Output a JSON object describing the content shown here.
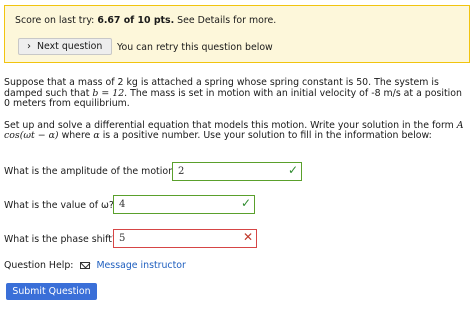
{
  "score": {
    "prefix": "Score on last try:",
    "value": "6.67 of 10 pts.",
    "suffix": "See Details for more."
  },
  "next_button": {
    "label": "Next question"
  },
  "retry_text": "You can retry this question below",
  "question": {
    "para1_a": "Suppose that a mass of 2 kg is attached a spring whose spring constant is 50. The system is damped such that",
    "para1_b": "b = 12",
    "para1_c": ". The mass is set in motion with an initial velocity of -8 m/s at a position 0 meters from equilibrium.",
    "para2_a": "Set up and solve a differential equation that models this motion. Write your solution in the form",
    "para2_math": "A cos(ωt − α)",
    "para2_b": "where",
    "para2_alpha": "α",
    "para2_c": "is a positive number. Use your solution to fill in the information below:"
  },
  "parts": [
    {
      "label": "What is the amplitude of the motion?",
      "value": "2",
      "status": "correct"
    },
    {
      "label": "What is the value of ω?",
      "value": "4",
      "status": "correct"
    },
    {
      "label": "What is the phase shift?",
      "value": "5",
      "status": "incorrect"
    }
  ],
  "help": {
    "label": "Question Help:",
    "link": "Message instructor"
  },
  "submit": {
    "label": "Submit Question"
  },
  "colors": {
    "correct": "#5aa02c",
    "incorrect": "#d64545",
    "link": "#1f5fbf",
    "submit": "#3a6fd8"
  }
}
